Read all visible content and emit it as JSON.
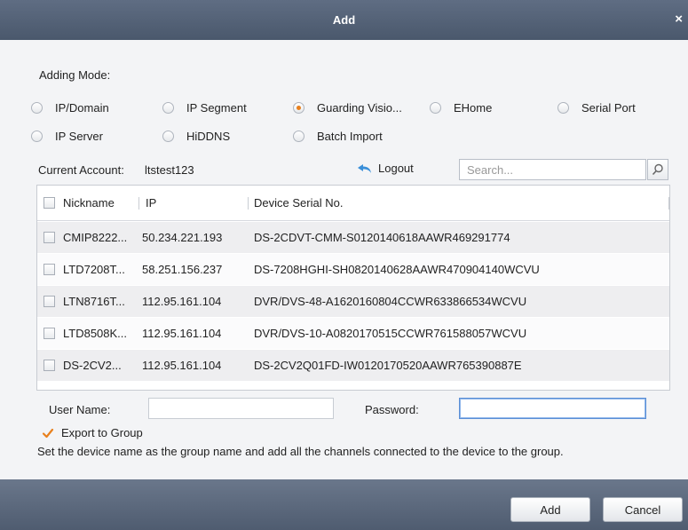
{
  "window": {
    "title": "Add",
    "close_glyph": "×"
  },
  "adding_mode": {
    "label": "Adding Mode:",
    "options": [
      {
        "label": "IP/Domain",
        "selected": false
      },
      {
        "label": "IP Segment",
        "selected": false
      },
      {
        "label": "Guarding Visio...",
        "selected": true
      },
      {
        "label": "EHome",
        "selected": false
      },
      {
        "label": "Serial Port",
        "selected": false
      },
      {
        "label": "IP Server",
        "selected": false
      },
      {
        "label": "HiDDNS",
        "selected": false
      },
      {
        "label": "Batch Import",
        "selected": false
      }
    ]
  },
  "account": {
    "label": "Current Account:",
    "value": "ltstest123",
    "logout_label": "Logout"
  },
  "search": {
    "placeholder": "Search...",
    "value": ""
  },
  "table": {
    "columns": [
      "Nickname",
      "IP",
      "Device Serial No."
    ],
    "rows": [
      {
        "nickname": "CMIP8222...",
        "ip": "50.234.221.193",
        "serial": "DS-2CDVT-CMM-S0120140618AAWR469291774"
      },
      {
        "nickname": "LTD7208T...",
        "ip": "58.251.156.237",
        "serial": "DS-7208HGHI-SH0820140628AAWR470904140WCVU"
      },
      {
        "nickname": "LTN8716T...",
        "ip": "112.95.161.104",
        "serial": "DVR/DVS-48-A1620160804CCWR633866534WCVU"
      },
      {
        "nickname": "LTD8508K...",
        "ip": "112.95.161.104",
        "serial": "DVR/DVS-10-A0820170515CCWR761588057WCVU"
      },
      {
        "nickname": "DS-2CV2...",
        "ip": "112.95.161.104",
        "serial": "DS-2CV2Q01FD-IW0120170520AAWR765390887E"
      }
    ]
  },
  "credentials": {
    "username_label": "User Name:",
    "username_value": "",
    "password_label": "Password:",
    "password_value": ""
  },
  "export": {
    "label": "Export to Group",
    "checked": true,
    "description": "Set the device name as the group name and add all the channels connected to the device to the group."
  },
  "buttons": {
    "add": "Add",
    "cancel": "Cancel"
  },
  "colors": {
    "accent_radio": "#e8801d",
    "titlebar": "#55637a",
    "check": "#e8801d",
    "logout_icon": "#3a8fd9"
  },
  "icons": {
    "logout": "undo-arrow-icon",
    "search": "magnifier-icon",
    "export": "checkmark-icon",
    "close": "close-icon"
  }
}
